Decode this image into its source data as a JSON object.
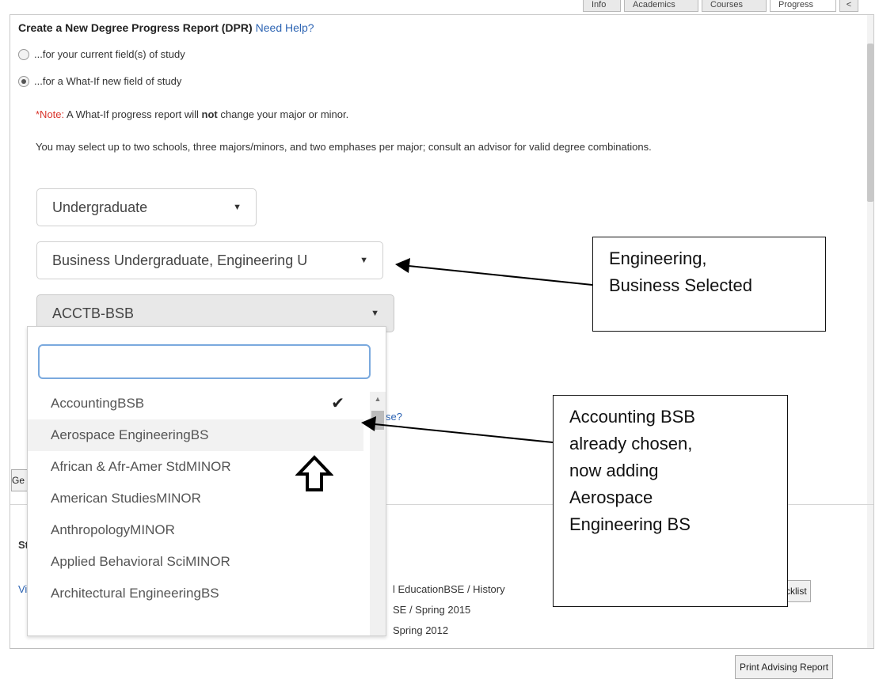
{
  "tabs": [
    {
      "label": "Info"
    },
    {
      "label": "Academics"
    },
    {
      "label": "Courses"
    },
    {
      "label": "Progress"
    }
  ],
  "tabs_more": "<",
  "header": {
    "title": "Create a New Degree Progress Report (DPR)",
    "help_link": "Need Help?"
  },
  "radios": [
    {
      "label": "...for your current field(s) of study",
      "checked": false
    },
    {
      "label": "...for a What-If new field of study",
      "checked": true
    }
  ],
  "note": {
    "prefix": "*Note:",
    "text_a": " A What-If progress report will ",
    "bold": "not",
    "text_b": " change your major or minor."
  },
  "advice": "You may select up to two schools, three majors/minors, and two emphases per major; consult an advisor for valid degree combinations.",
  "selects": {
    "career": "Undergraduate",
    "schools": "Business Undergraduate, Engineering U",
    "program": "ACCTB-BSB"
  },
  "dropdown": {
    "search_value": "",
    "items": [
      {
        "label": "AccountingBSB",
        "checked": true
      },
      {
        "label": "Aerospace EngineeringBS",
        "checked": false
      },
      {
        "label": "African & Afr-Amer StdMINOR",
        "checked": false
      },
      {
        "label": "American StudiesMINOR",
        "checked": false
      },
      {
        "label": "AnthropologyMINOR",
        "checked": false
      },
      {
        "label": "Applied Behavioral SciMINOR",
        "checked": false
      },
      {
        "label": "Architectural EngineeringBS",
        "checked": false
      }
    ],
    "check_glyph": "✔"
  },
  "background": {
    "emphasis_link_fragment": "se?",
    "generate_btn_fragment": "Ge",
    "section_fragment": "Sto",
    "view_fragment": "Vie",
    "row1": "l EducationBSE / History",
    "row2": "SE / Spring 2015",
    "row3": "Spring 2012",
    "checklist_btn_fragment": "cklist"
  },
  "callouts": {
    "first": [
      "Engineering,",
      "Business Selected"
    ],
    "second": [
      "Accounting BSB",
      "already chosen,",
      "now adding",
      "Aerospace",
      "Engineering BS"
    ]
  },
  "print_button": "Print Advising Report"
}
